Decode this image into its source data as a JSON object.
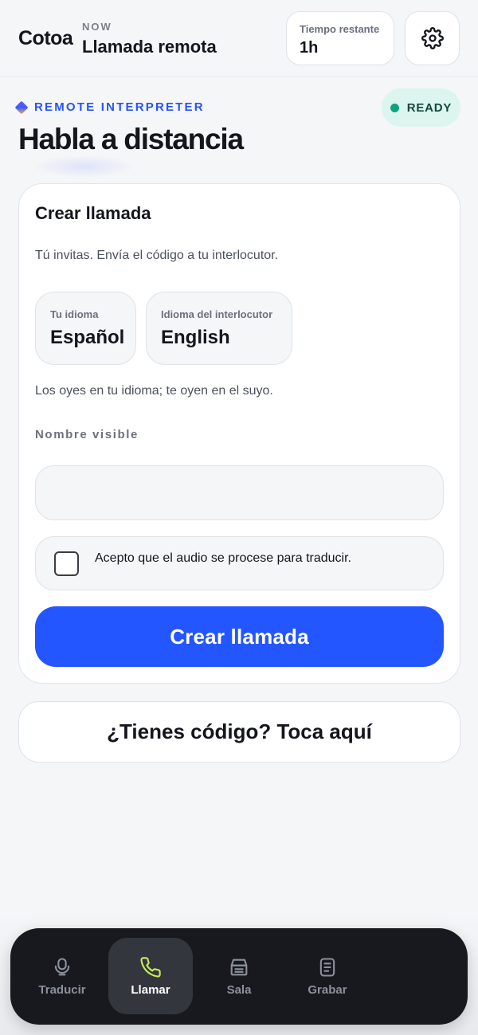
{
  "header": {
    "brand": "Cotoa",
    "now_label": "NOW",
    "screen_title": "Llamada remota",
    "time_label": "Tiempo restante",
    "time_value": "1h",
    "settings_icon": "gear-icon"
  },
  "hero": {
    "kicker": "REMOTE INTERPRETER",
    "title": "Habla a distancia",
    "status": "READY",
    "status_color": "#10a37f"
  },
  "card": {
    "title": "Crear llamada",
    "subtitle": "Tú invitas. Envía el código a tu interlocutor.",
    "my_language_label": "Tu idioma",
    "my_language": "Español",
    "peer_language_label": "Idioma del interlocutor",
    "peer_language": "English",
    "language_note": "Los oyes en tu idioma; te oyen en el suyo.",
    "name_label": "Nombre visible",
    "name_value": "",
    "name_placeholder": "",
    "consent_text": "Acepto que el audio se procese para traducir.",
    "consent_checked": false,
    "create_button": "Crear llamada"
  },
  "code_button": "¿Tienes código? Toca aquí",
  "nav": {
    "items": [
      {
        "label": "Traducir",
        "icon": "microphone-icon",
        "active": false
      },
      {
        "label": "Llamar",
        "icon": "phone-icon",
        "active": true
      },
      {
        "label": "Sala",
        "icon": "room-icon",
        "active": false
      },
      {
        "label": "Grabar",
        "icon": "document-icon",
        "active": false
      }
    ]
  },
  "colors": {
    "accent": "#2456ff",
    "active_icon": "#c6ef5a",
    "nav_bg": "#17191f"
  }
}
